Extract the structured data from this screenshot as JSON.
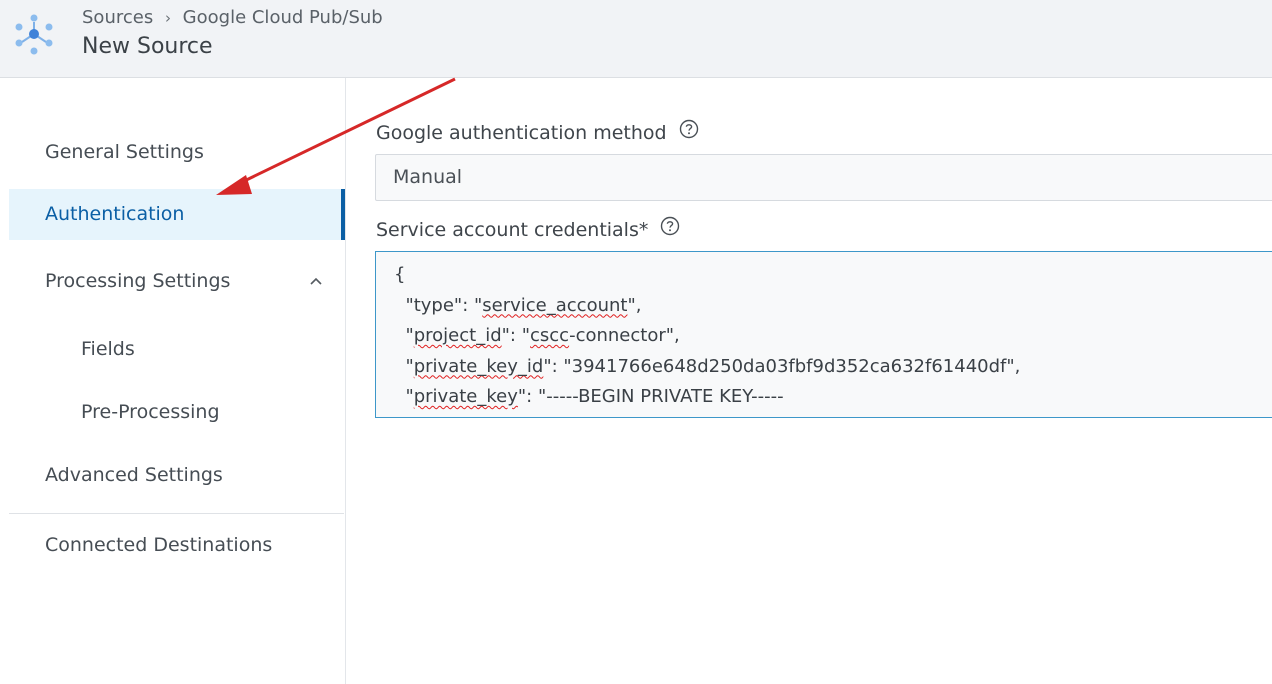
{
  "header": {
    "breadcrumb": [
      "Sources",
      "Google Cloud Pub/Sub"
    ],
    "separator": "›",
    "title": "New Source",
    "logo_icon": "network-nodes-icon"
  },
  "sidebar": {
    "items": [
      {
        "label": "General Settings",
        "active": false
      },
      {
        "label": "Authentication",
        "active": true
      },
      {
        "label": "Processing Settings",
        "expanded": true
      },
      {
        "label": "Fields",
        "sub": true
      },
      {
        "label": "Pre-Processing",
        "sub": true
      },
      {
        "label": "Advanced Settings"
      },
      {
        "label": "Connected Destinations"
      }
    ]
  },
  "form": {
    "auth_method": {
      "label": "Google authentication method",
      "value": "Manual"
    },
    "credentials": {
      "label": "Service account credentials*",
      "lines": [
        "{",
        "  \"type\": \"service_account\",",
        "  \"project_id\": \"cscc-connector\",",
        "  \"private_key_id\": \"3941766e648d250da03fbf9d352ca632f61440df\",",
        "  \"private_key\": \"-----BEGIN PRIVATE KEY-----"
      ]
    }
  },
  "colors": {
    "accent": "#0b5fa5",
    "active_bg": "#e6f4fc",
    "annotation_arrow": "#d62828",
    "header_bg": "#f1f3f6"
  }
}
